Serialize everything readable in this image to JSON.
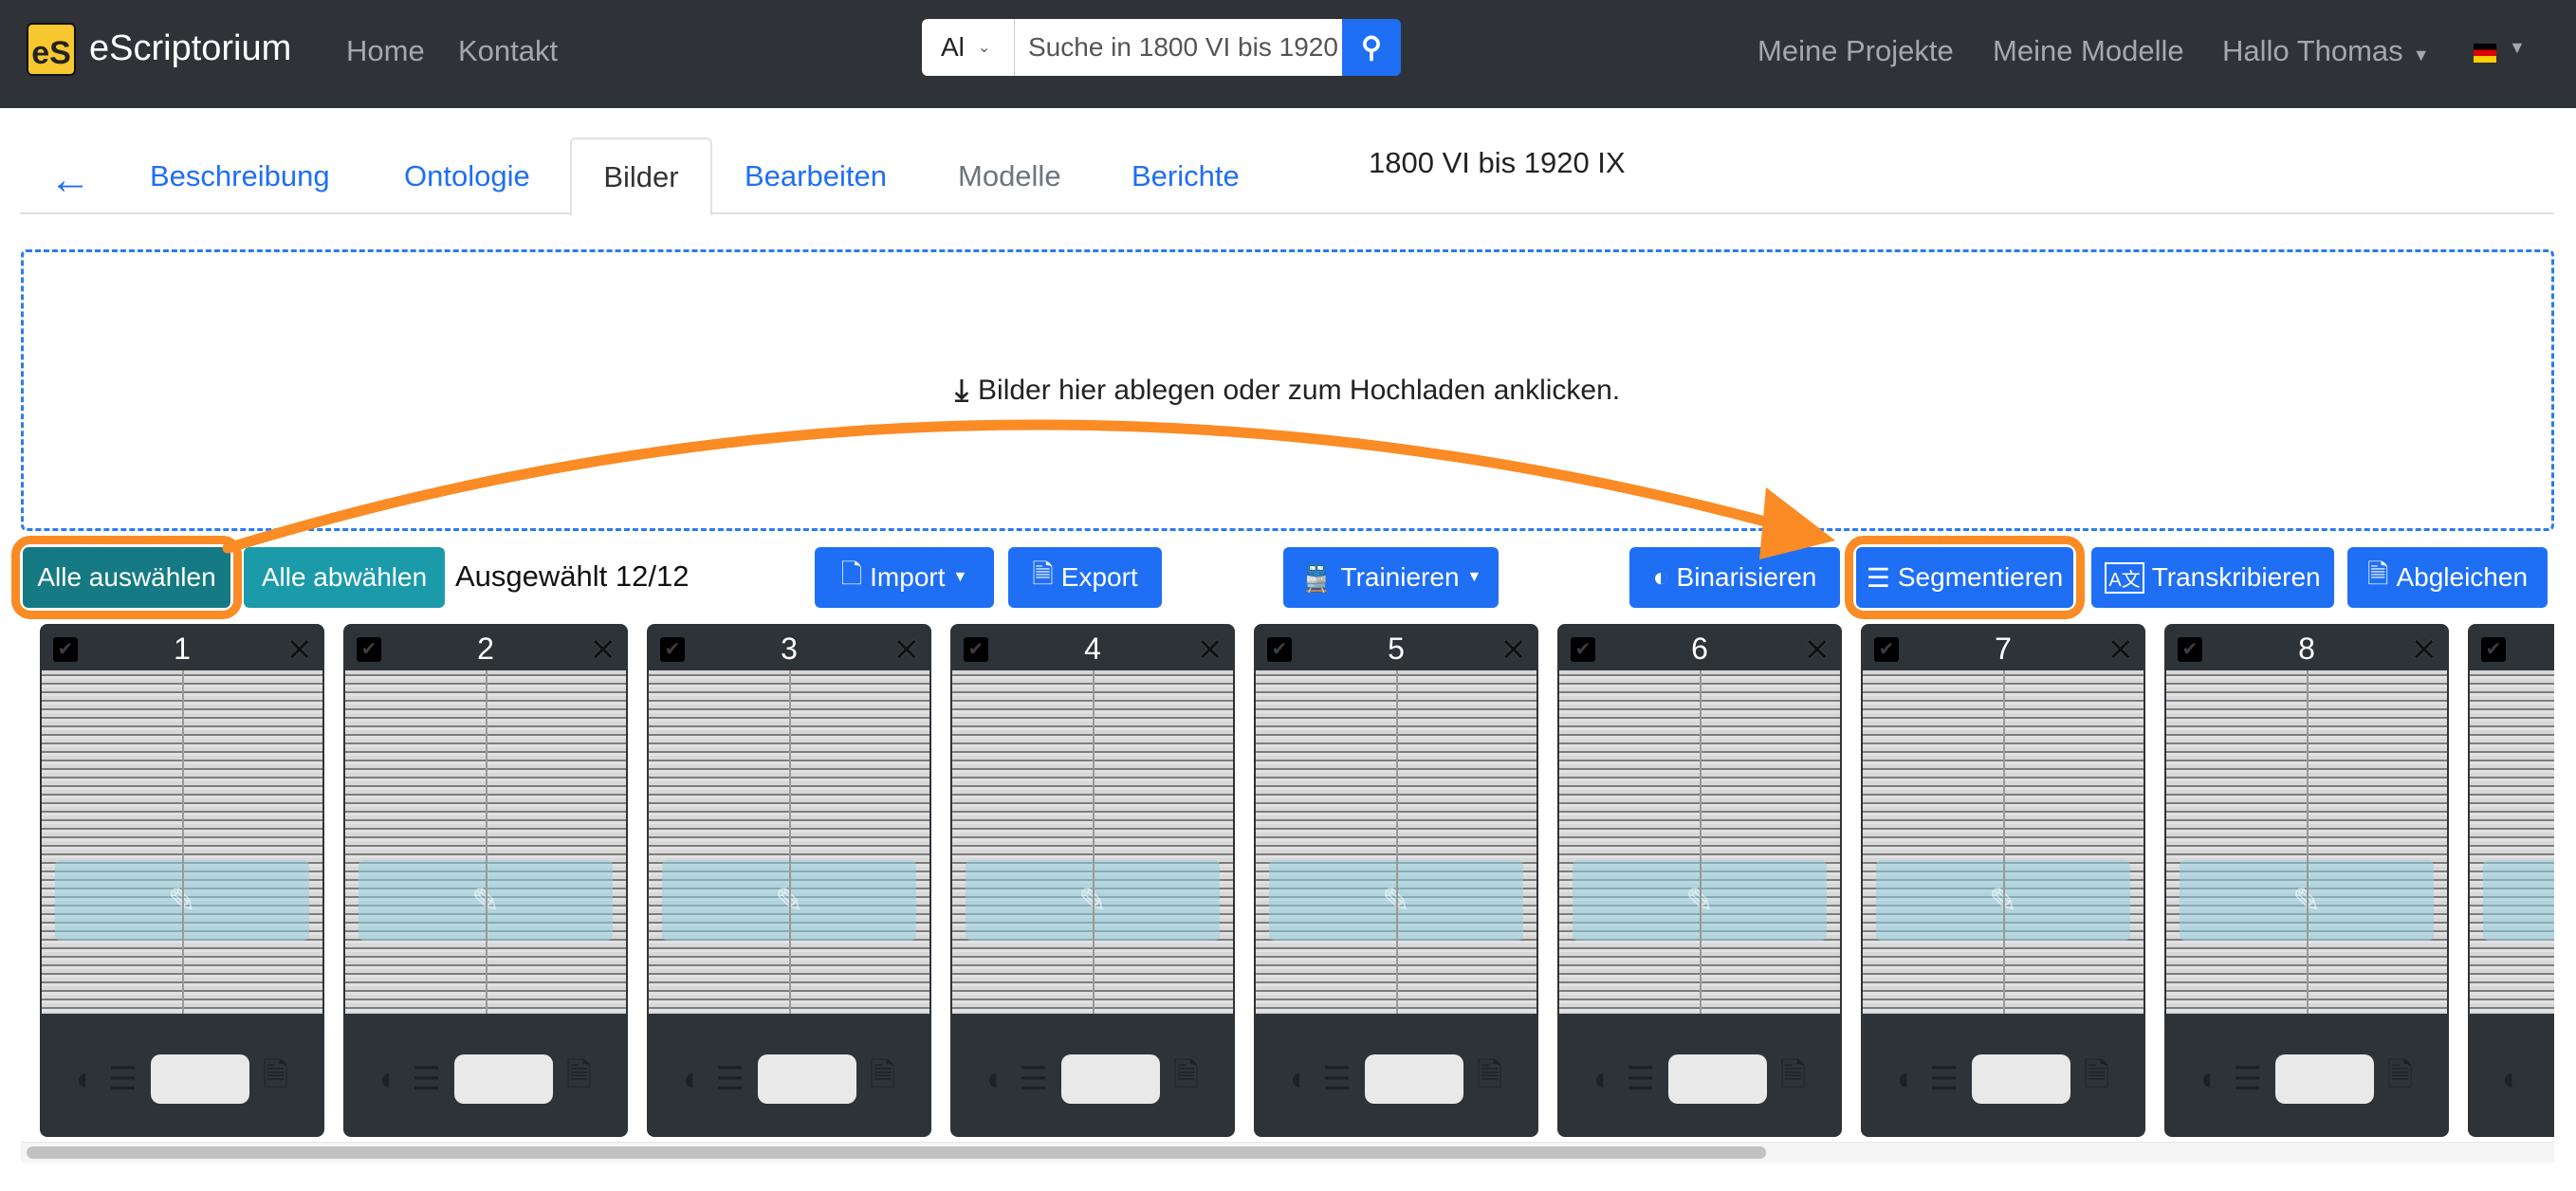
{
  "navbar": {
    "brand": "eScriptorium",
    "logo_text": "eS",
    "links": [
      "Home",
      "Kontakt"
    ],
    "search_scope": "Al",
    "search_value": "Suche in 1800 VI bis 1920 IX",
    "right_links": [
      "Meine Projekte",
      "Meine Modelle"
    ],
    "user": "Hallo Thomas",
    "language_flag": "de"
  },
  "tabs": [
    {
      "label": "Beschreibung"
    },
    {
      "label": "Ontologie"
    },
    {
      "label": "Bilder",
      "active": true
    },
    {
      "label": "Bearbeiten"
    },
    {
      "label": "Modelle"
    },
    {
      "label": "Berichte"
    }
  ],
  "document_title": "1800 VI bis 1920 IX",
  "dropzone": {
    "text": "Bilder hier ablegen oder zum Hochladen anklicken."
  },
  "toolbar": {
    "select_all": "Alle auswählen",
    "deselect_all": "Alle abwählen",
    "selected_count": "Ausgewählt 12/12",
    "import": "Import",
    "export": "Export",
    "train": "Trainieren",
    "binarize": "Binarisieren",
    "segment": "Segmentieren",
    "transcribe": "Transkribieren",
    "align": "Abgleichen"
  },
  "highlight_color": "#fb8b24",
  "accent_color": "#1f6ff5",
  "cards": [
    {
      "number": "1"
    },
    {
      "number": "2"
    },
    {
      "number": "3"
    },
    {
      "number": "4"
    },
    {
      "number": "5"
    },
    {
      "number": "6"
    },
    {
      "number": "7"
    },
    {
      "number": "8"
    },
    {
      "number": ""
    }
  ]
}
